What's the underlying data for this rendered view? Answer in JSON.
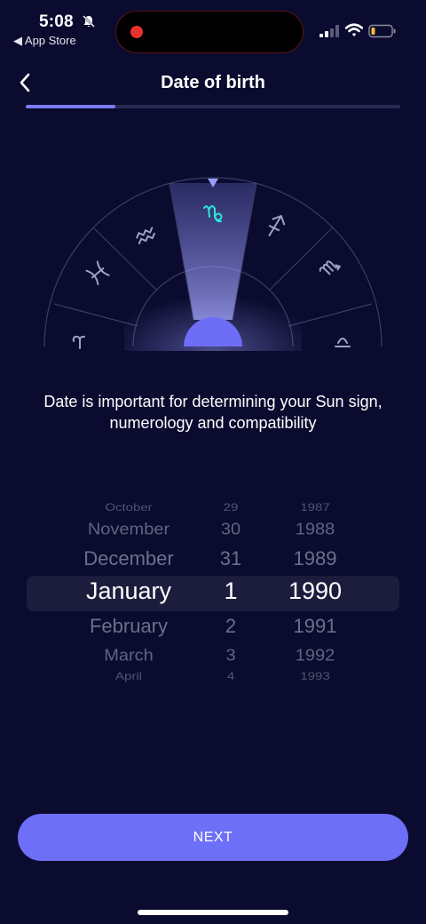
{
  "status_bar": {
    "time": "5:08",
    "back_app": "◀ App Store"
  },
  "header": {
    "title": "Date of birth",
    "progress": 0.24
  },
  "wheel": {
    "visible_signs": [
      "sagittarius",
      "capricorn",
      "aquarius",
      "pisces",
      "scorpio",
      "libra",
      "aries"
    ],
    "selected_sign": "capricorn",
    "accent_color": "#2ee6d6"
  },
  "description": "Date is important for determining your Sun sign, numerology and compatibility",
  "picker": {
    "months": [
      "October",
      "November",
      "December",
      "January",
      "February",
      "March",
      "April"
    ],
    "days": [
      "29",
      "30",
      "31",
      "1",
      "2",
      "3",
      "4"
    ],
    "years": [
      "1987",
      "1988",
      "1989",
      "1990",
      "1991",
      "1992",
      "1993"
    ],
    "selected_index": 3
  },
  "next_button": {
    "label": "NEXT"
  },
  "colors": {
    "background": "#0a0b2e",
    "accent": "#6e6ff7",
    "progress_track": "#252a52",
    "picker_highlight": "#1c1d3d"
  }
}
